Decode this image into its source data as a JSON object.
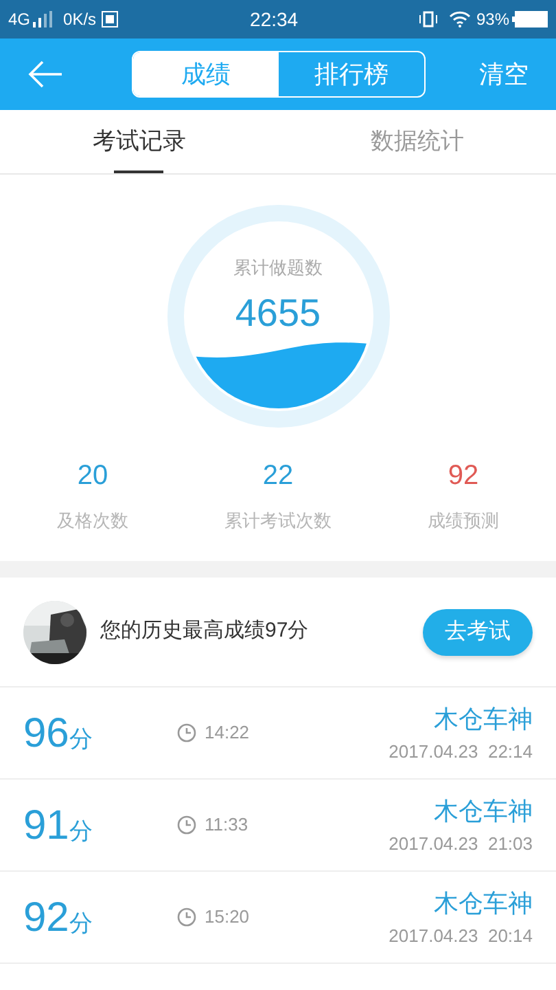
{
  "status_bar": {
    "network": "4G",
    "speed": "0K/s",
    "time": "22:34",
    "battery": "93%"
  },
  "header": {
    "segments": [
      {
        "label": "成绩",
        "selected": true
      },
      {
        "label": "排行榜",
        "selected": false
      }
    ],
    "action": "清空"
  },
  "tabs": [
    {
      "label": "考试记录",
      "selected": true
    },
    {
      "label": "数据统计",
      "selected": false
    }
  ],
  "summary": {
    "label": "累计做题数",
    "value": "4655"
  },
  "stats": [
    {
      "value": "20",
      "label": "及格次数",
      "color": "#2a9fd8"
    },
    {
      "value": "22",
      "label": "累计考试次数",
      "color": "#2a9fd8"
    },
    {
      "value": "92",
      "label": "成绩预测",
      "color": "#e05a55"
    }
  ],
  "best": {
    "text": "您的历史最高成绩97分",
    "button": "去考试"
  },
  "records": [
    {
      "score": "96",
      "unit": "分",
      "duration": "14:22",
      "name": "木仓车神",
      "date": "2017.04.23  22:14"
    },
    {
      "score": "91",
      "unit": "分",
      "duration": "11:33",
      "name": "木仓车神",
      "date": "2017.04.23  21:03"
    },
    {
      "score": "92",
      "unit": "分",
      "duration": "15:20",
      "name": "木仓车神",
      "date": "2017.04.23  20:14"
    }
  ]
}
